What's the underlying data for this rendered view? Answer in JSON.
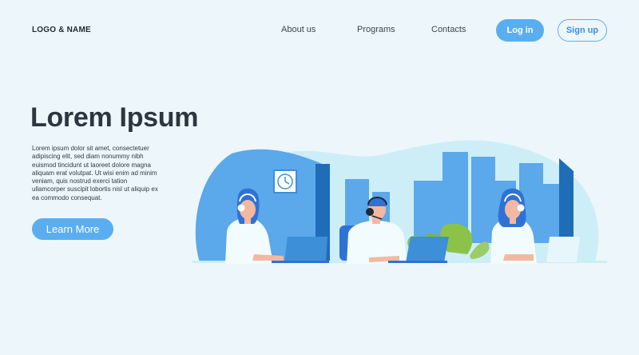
{
  "header": {
    "logo": "LOGO & NAME",
    "nav": [
      "About us",
      "Programs",
      "Contacts"
    ],
    "login_label": "Log in",
    "signup_label": "Sign up"
  },
  "hero": {
    "title": "Lorem Ipsum",
    "body": "Lorem ipsum dolor sit amet, consectetuer adipiscing elit, sed diam nonummy nibh euismod tincidunt ut laoreet dolore magna aliquam erat volutpat. Ut wisi enim ad minim veniam, quis nostrud exerci tation ullamcorper suscipit lobortis nisl ut aliquip ex ea commodo consequat.",
    "button_label": "Learn More"
  },
  "colors": {
    "background": "#edf6fb",
    "accent": "#5aaef0",
    "blob_dark": "#5ba8ea",
    "blob_light": "#cdeef7",
    "wall_dark": "#1f6db7"
  },
  "illustration": {
    "subject": "call-center-operators",
    "icons": [
      "wall-clock-icon",
      "headset-icon",
      "laptop-icon",
      "potted-plant-icon",
      "city-skyline-icon"
    ]
  }
}
